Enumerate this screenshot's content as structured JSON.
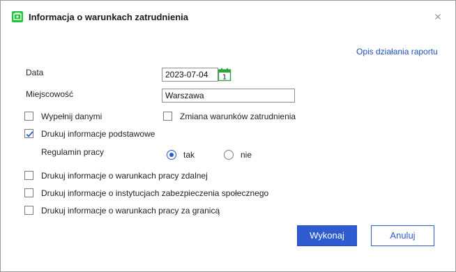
{
  "dialog": {
    "title": "Informacja o warunkach zatrudnienia",
    "report_help_link": "Opis działania raportu"
  },
  "form": {
    "date_label": "Data",
    "date_value": "2023-07-04",
    "calendar_day": "1",
    "city_label": "Miejscowość",
    "city_value": "Warszawa",
    "fill_with_data": {
      "label": "Wypełnij danymi",
      "checked": false
    },
    "change_conditions": {
      "label": "Zmiana warunków zatrudnienia",
      "checked": false
    },
    "print_basic_info": {
      "label": "Drukuj informacje podstawowe",
      "checked": true
    },
    "work_regulations": {
      "label": "Regulamin pracy",
      "options": [
        "tak",
        "nie"
      ],
      "selected": "tak"
    },
    "print_remote_work": {
      "label": "Drukuj informacje o warunkach pracy zdalnej",
      "checked": false
    },
    "print_social_security": {
      "label": "Drukuj informacje o instytucjach zabezpieczenia społecznego",
      "checked": false
    },
    "print_work_abroad": {
      "label": "Drukuj informacje o warunkach pracy za granicą",
      "checked": false
    }
  },
  "buttons": {
    "ok_label": "Wykonaj",
    "cancel_label": "Anuluj"
  },
  "colors": {
    "accent": "#2f5bd0",
    "link": "#1f4fb8",
    "app_icon": "#21c43a"
  }
}
